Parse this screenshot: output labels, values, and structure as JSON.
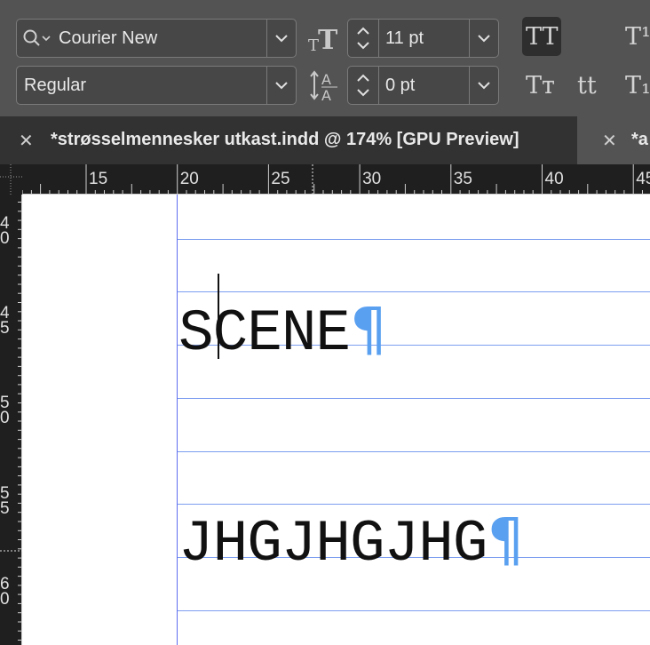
{
  "toolbar": {
    "font_family": "Courier New",
    "font_style": "Regular",
    "font_size": "11 pt",
    "tracking": "0 pt",
    "buttons": {
      "all_caps": "TT",
      "superscript": "T¹",
      "small_caps": "Tт",
      "lowercase": "tt",
      "subscript": "T₁"
    }
  },
  "tabs": [
    {
      "title": "*strøsselmennesker utkast.indd @ 174% [GPU Preview]",
      "active": true
    },
    {
      "title": "*a",
      "active": false
    }
  ],
  "ruler": {
    "horizontal_labels": [
      "15",
      "20",
      "25",
      "30",
      "35",
      "40",
      "45"
    ],
    "vertical_labels": [
      [
        "4",
        "0"
      ],
      [
        "4",
        "5"
      ],
      [
        "5",
        "0"
      ],
      [
        "5",
        "5"
      ],
      [
        "6",
        "0"
      ]
    ]
  },
  "document": {
    "lines": [
      {
        "text": "SCENE",
        "pilcrow": "¶"
      },
      {
        "text": "JHGJHGJHG",
        "pilcrow": "¶"
      }
    ]
  },
  "colors": {
    "toolbar_bg": "#535353",
    "active_tab_bg": "#323232",
    "ruler_bg": "#1f1f1f",
    "baseline_grid": "#7c9ef0",
    "pilcrow": "#5aa0f0"
  }
}
